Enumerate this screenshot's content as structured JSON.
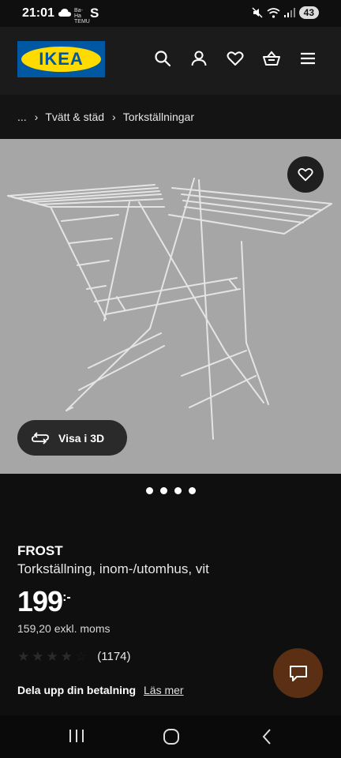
{
  "status_bar": {
    "time": "21:01",
    "small_text": "Ba-Ha TEMU",
    "carrier_letter": "S",
    "battery": "43"
  },
  "header": {
    "logo_text": "IKEA",
    "icons": [
      "search-icon",
      "user-icon",
      "heart-icon",
      "basket-icon",
      "menu-icon"
    ]
  },
  "breadcrumb": {
    "items": [
      "...",
      "Tvätt & städ",
      "Torkställningar"
    ]
  },
  "product_image": {
    "view_3d_label": "Visa i 3D",
    "image_count": 4
  },
  "product": {
    "brand": "FROST",
    "description": "Torkställning, inom-/utomhus, vit",
    "price": "199",
    "price_suffix": ":-",
    "price_excl": "159,20 exkl. moms",
    "rating_stars": 4,
    "rating_max": 5,
    "review_count": "(1174)"
  },
  "payment": {
    "title": "Dela upp din betalning",
    "link": "Läs mer"
  },
  "colors": {
    "ikea_blue": "#0058a3",
    "ikea_yellow": "#ffdb00",
    "chat_button": "#5a2f14"
  }
}
